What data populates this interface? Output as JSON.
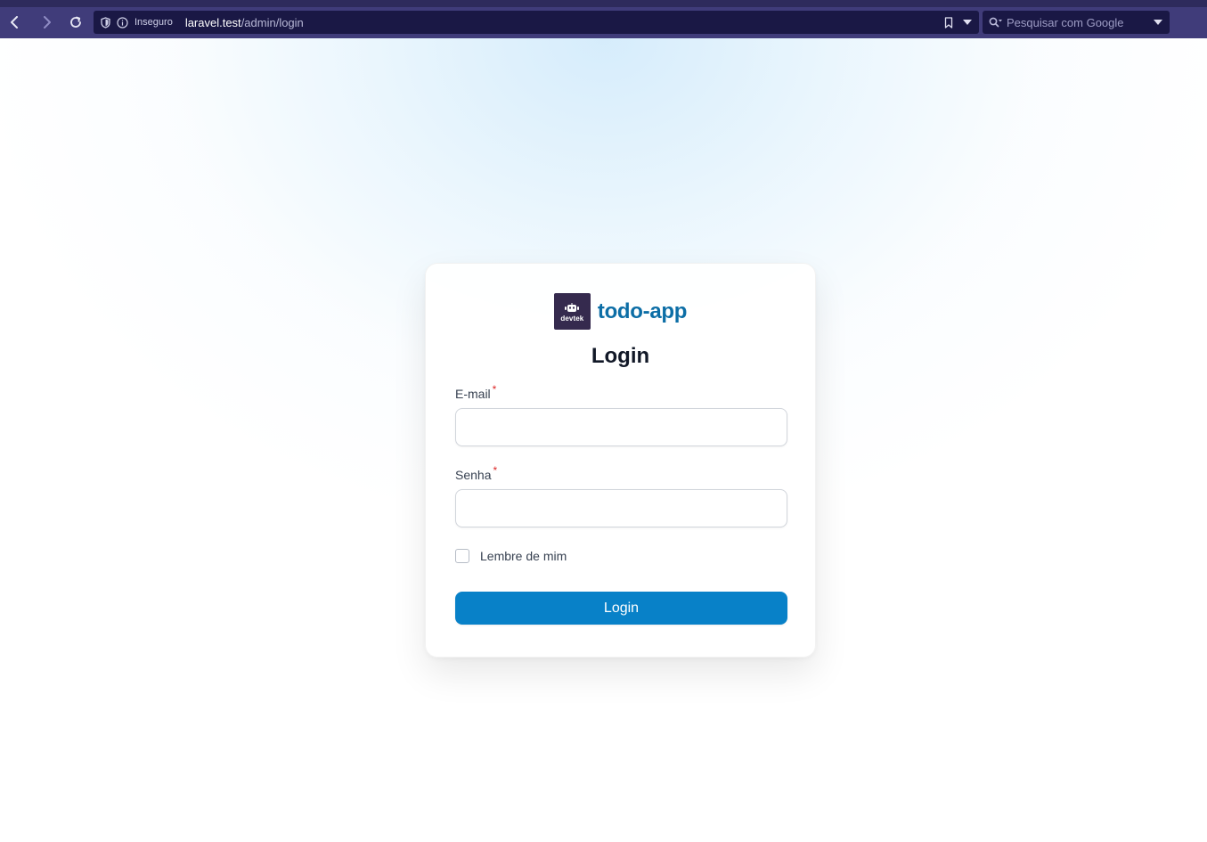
{
  "browser": {
    "insecure_label": "Inseguro",
    "url_host": "laravel.test",
    "url_path": "/admin/login",
    "search_placeholder": "Pesquisar com Google"
  },
  "brand": {
    "logo_text": "devtek",
    "name": "todo-app"
  },
  "form": {
    "heading": "Login",
    "email_label": "E-mail",
    "email_value": "",
    "password_label": "Senha",
    "password_value": "",
    "required_marker": "*",
    "remember_label": "Lembre de mim",
    "remember_checked": false,
    "submit_label": "Login"
  },
  "colors": {
    "browser_bar": "#403c7a",
    "url_field": "#1a1845",
    "brand_accent": "#0c6ea6",
    "primary_button": "#0881c8",
    "required": "#dc2626"
  },
  "icons": [
    "back-icon",
    "forward-icon",
    "reload-icon",
    "shield-icon",
    "info-icon",
    "bookmark-icon",
    "chevron-down-icon",
    "search-icon",
    "robot-icon"
  ]
}
